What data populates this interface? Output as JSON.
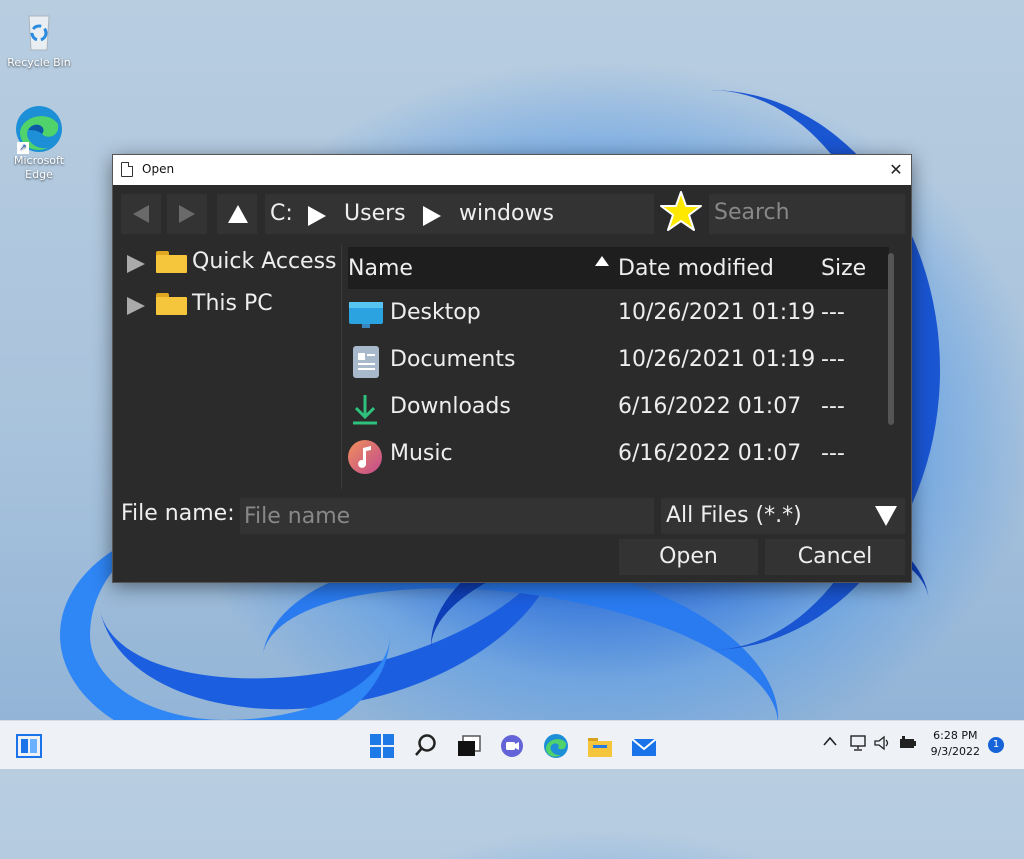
{
  "desktop": {
    "recycle_bin_label": "Recycle Bin",
    "edge_label_line1": "Microsoft",
    "edge_label_line2": "Edge"
  },
  "dialog": {
    "title": "Open",
    "close_glyph": "✕",
    "path": [
      "C:",
      "Users",
      "windows"
    ],
    "search_placeholder": "Search",
    "sidebar": [
      {
        "label": "Quick Access"
      },
      {
        "label": "This PC"
      }
    ],
    "columns": {
      "name": "Name",
      "date": "Date modified",
      "size": "Size"
    },
    "files": [
      {
        "name": "Desktop",
        "date": "10/26/2021 01:19",
        "size": "---",
        "icon": "desktop-folder-icon"
      },
      {
        "name": "Documents",
        "date": "10/26/2021 01:19",
        "size": "---",
        "icon": "documents-folder-icon"
      },
      {
        "name": "Downloads",
        "date": "6/16/2022 01:07",
        "size": "---",
        "icon": "downloads-folder-icon"
      },
      {
        "name": "Music",
        "date": "6/16/2022 01:07",
        "size": "---",
        "icon": "music-folder-icon"
      }
    ],
    "file_name_label": "File name:",
    "file_name_placeholder": "File name",
    "file_name_value": "",
    "filter_value": "All Files (*.*)",
    "open_button": "Open",
    "cancel_button": "Cancel"
  },
  "taskbar": {
    "time": "6:28 PM",
    "date": "9/3/2022",
    "notification_count": "1",
    "tray_chevron": "^",
    "accent": "#1764d8"
  }
}
